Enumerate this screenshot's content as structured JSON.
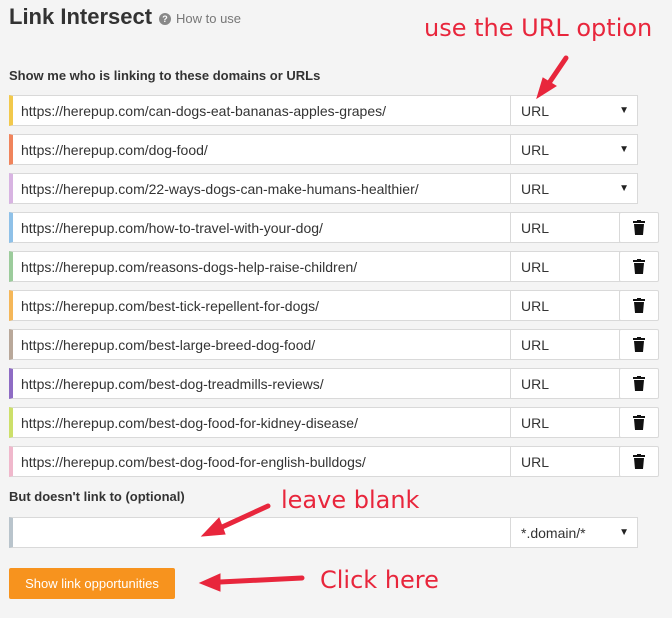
{
  "header": {
    "title": "Link Intersect",
    "help": "How to use"
  },
  "section1": {
    "label": "Show me who is linking to these domains or URLs"
  },
  "rows": [
    {
      "url": "https://herepup.com/can-dogs-eat-bananas-apples-grapes/",
      "mode": "URL",
      "color": "#f2c94c",
      "trash": false
    },
    {
      "url": "https://herepup.com/dog-food/",
      "mode": "URL",
      "color": "#f0845c",
      "trash": false
    },
    {
      "url": "https://herepup.com/22-ways-dogs-can-make-humans-healthier/",
      "mode": "URL",
      "color": "#d8b4e2",
      "trash": false
    },
    {
      "url": "https://herepup.com/how-to-travel-with-your-dog/",
      "mode": "URL",
      "color": "#8fc1e8",
      "trash": true
    },
    {
      "url": "https://herepup.com/reasons-dogs-help-raise-children/",
      "mode": "URL",
      "color": "#9ccc9c",
      "trash": true
    },
    {
      "url": "https://herepup.com/best-tick-repellent-for-dogs/",
      "mode": "URL",
      "color": "#f5b759",
      "trash": true
    },
    {
      "url": "https://herepup.com/best-large-breed-dog-food/",
      "mode": "URL",
      "color": "#b9a89a",
      "trash": true
    },
    {
      "url": "https://herepup.com/best-dog-treadmills-reviews/",
      "mode": "URL",
      "color": "#8e6cc4",
      "trash": true
    },
    {
      "url": "https://herepup.com/best-dog-food-for-kidney-disease/",
      "mode": "URL",
      "color": "#cde06a",
      "trash": true
    },
    {
      "url": "https://herepup.com/best-dog-food-for-english-bulldogs/",
      "mode": "URL",
      "color": "#f0b8cc",
      "trash": true
    }
  ],
  "section2": {
    "label": "But doesn't link to (optional)"
  },
  "exclude": {
    "value": "",
    "mode": "*.domain/*",
    "color": "#b9c4cc"
  },
  "button": {
    "label": "Show link opportunities"
  },
  "annotations": {
    "url_option": "use the URL option",
    "leave_blank": "leave blank",
    "click_here": "Click here"
  }
}
